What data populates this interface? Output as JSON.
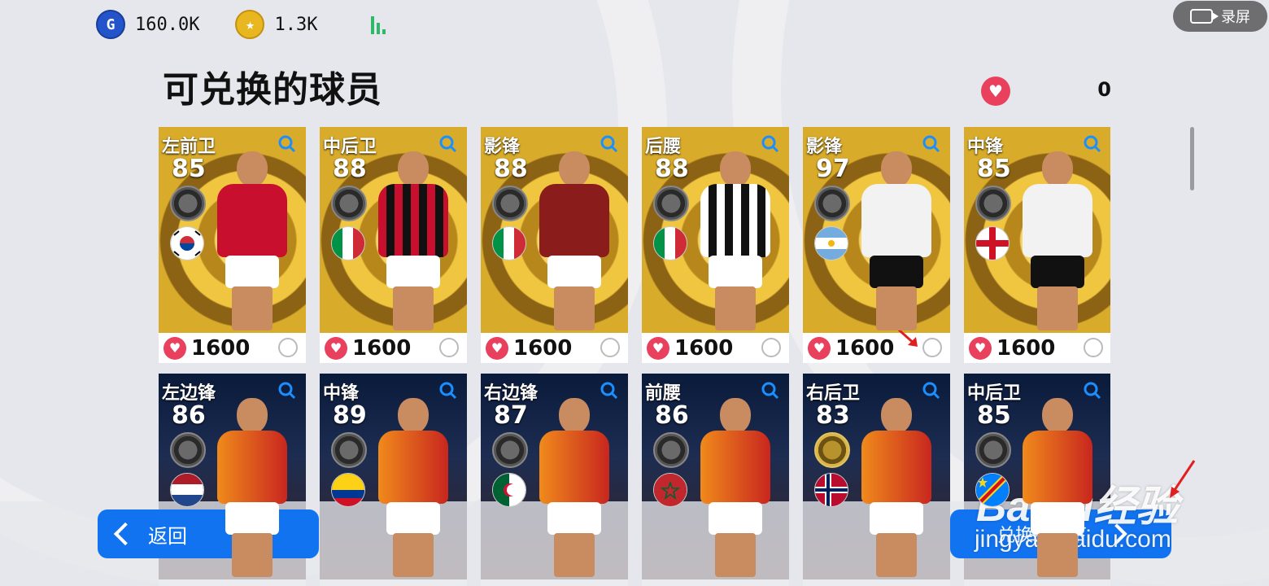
{
  "currencies": [
    {
      "icon": "g-coin-icon",
      "letter": "G",
      "value": "160.0K"
    },
    {
      "icon": "star-coin-icon",
      "letter": "★",
      "value": "1.3K"
    }
  ],
  "record_button": {
    "label": "录屏"
  },
  "page_title": "可兑换的球员",
  "points": {
    "value": "0"
  },
  "cards": [
    {
      "position": "左前卫",
      "rating": "85",
      "price": "1600",
      "flag": "korea",
      "style": "gold",
      "kit": "red"
    },
    {
      "position": "中后卫",
      "rating": "88",
      "price": "1600",
      "flag": "italy",
      "style": "gold",
      "kit": "redblack"
    },
    {
      "position": "影锋",
      "rating": "88",
      "price": "1600",
      "flag": "italy",
      "style": "gold",
      "kit": "maroon"
    },
    {
      "position": "后腰",
      "rating": "88",
      "price": "1600",
      "flag": "italy",
      "style": "gold",
      "kit": "stripes"
    },
    {
      "position": "影锋",
      "rating": "97",
      "price": "1600",
      "flag": "argentina",
      "style": "gold",
      "kit": "white"
    },
    {
      "position": "中锋",
      "rating": "85",
      "price": "1600",
      "flag": "england",
      "style": "gold",
      "kit": "white"
    },
    {
      "position": "左边锋",
      "rating": "86",
      "price": "",
      "flag": "netherlands",
      "style": "dark",
      "kit": "gala"
    },
    {
      "position": "中锋",
      "rating": "89",
      "price": "",
      "flag": "colombia",
      "style": "dark",
      "kit": "gala"
    },
    {
      "position": "右边锋",
      "rating": "87",
      "price": "",
      "flag": "algeria",
      "style": "dark",
      "kit": "gala"
    },
    {
      "position": "前腰",
      "rating": "86",
      "price": "",
      "flag": "morocco",
      "style": "dark",
      "kit": "gala"
    },
    {
      "position": "右后卫",
      "rating": "83",
      "price": "",
      "flag": "norway",
      "style": "dark",
      "kit": "gala"
    },
    {
      "position": "中后卫",
      "rating": "85",
      "price": "",
      "flag": "drcongo",
      "style": "dark",
      "kit": "gala"
    }
  ],
  "back_button": {
    "label": "返回"
  },
  "confirm_button": {
    "label": "兑换并签下"
  },
  "watermark": {
    "brand": "Baidu经验",
    "url": "jingyan.baidu.com"
  },
  "colors": {
    "accent": "#1173ef",
    "heart": "#e8405d",
    "signal": "#2fb86a"
  }
}
